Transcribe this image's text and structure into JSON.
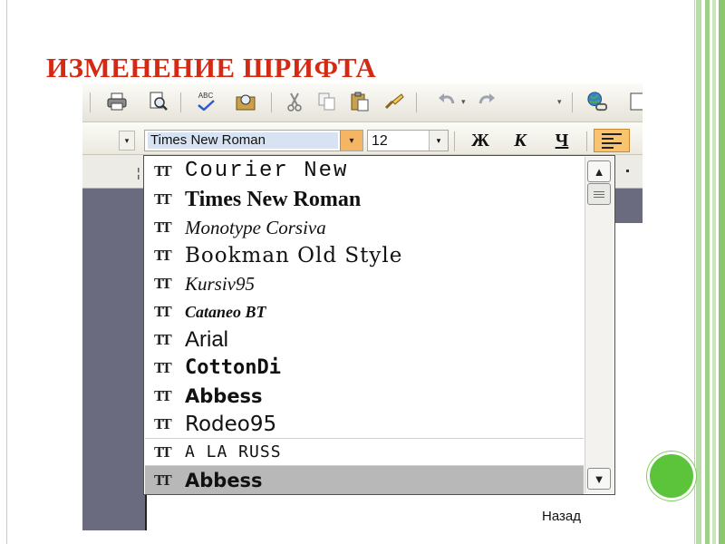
{
  "slide": {
    "title": "ИЗМЕНЕНИЕ ШРИФТА",
    "back_link": "Назад"
  },
  "toolbar": {
    "icons": [
      "print-icon",
      "print-preview-icon",
      "spellcheck-icon",
      "research-icon",
      "cut-icon",
      "copy-icon",
      "paste-icon",
      "format-painter-icon",
      "undo-icon",
      "redo-icon",
      "hyperlink-icon"
    ],
    "spellcheck_label": "ABC"
  },
  "formatting": {
    "font_value": "Times New Roman",
    "size_value": "12",
    "bold_label": "Ж",
    "italic_label": "К",
    "underline_label": "Ч",
    "align_state": "left-active"
  },
  "font_list": {
    "items": [
      {
        "name": "Courier New"
      },
      {
        "name": "Times New Roman"
      },
      {
        "name": "Monotype Corsiva"
      },
      {
        "name": "Bookman Old Style"
      },
      {
        "name": "Kursiv95"
      },
      {
        "name": "Cataneo BT"
      },
      {
        "name": "Arial"
      },
      {
        "name": "CottonDi"
      },
      {
        "name": "Abbess"
      },
      {
        "name": "Rodeo95"
      },
      {
        "name": "A LA RUSS"
      },
      {
        "name": "Abbess"
      }
    ],
    "selected_index": 11,
    "hover_index": 10
  },
  "colors": {
    "title": "#d42a14",
    "accent_green": "#5cc43a",
    "font_combo_arrow": "#f4b565",
    "align_active": "#f8c46f"
  }
}
